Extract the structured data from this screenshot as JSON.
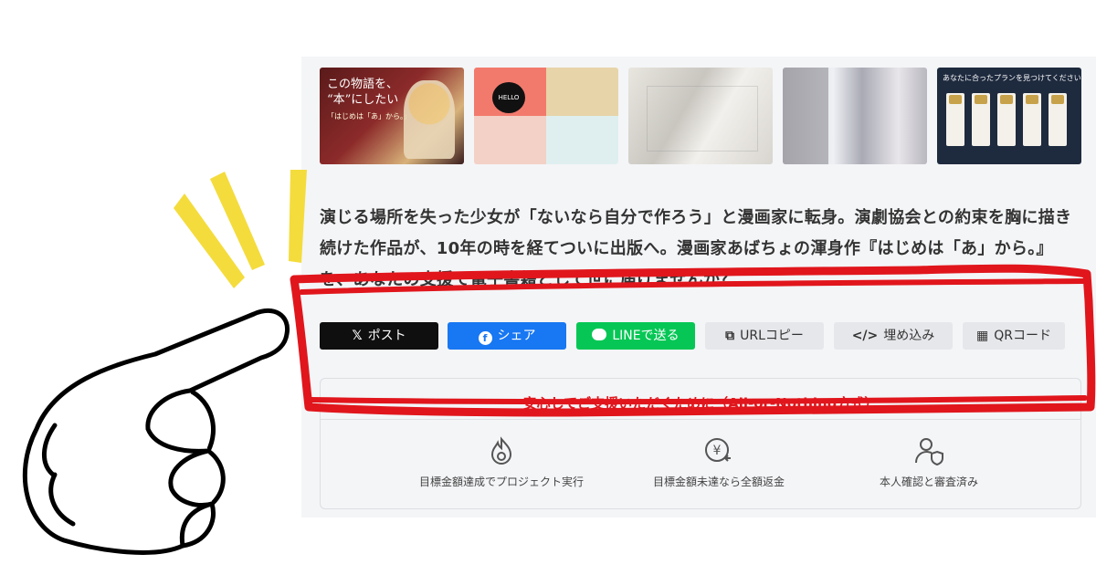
{
  "thumbnails": [
    {
      "title_line1": "この物語を、",
      "title_line2": "“本”にしたい",
      "subtitle": "「はじめは「あ」から。」"
    },
    {
      "text": "HELLO"
    },
    {},
    {},
    {
      "title": "あなたに合ったプランを見つけてください"
    }
  ],
  "description": "演じる場所を失った少女が「ないなら自分で作ろう」と漫画家に転身。演劇協会との約束を胸に描き続けた作品が、10年の時を経てついに出版へ。漫画家あばちょの渾身作『はじめは「あ」から。』を、あなたの支援で電子書籍として世に届けませんか？",
  "share": {
    "post": {
      "icon": "x-icon",
      "label": "ポスト"
    },
    "share": {
      "icon": "facebook-icon",
      "label": "シェア"
    },
    "line": {
      "icon": "line-icon",
      "label": "LINEで送る"
    },
    "url": {
      "icon": "copy-icon",
      "label": "URLコピー"
    },
    "embed": {
      "icon": "code-icon",
      "label": "埋め込み"
    },
    "qr": {
      "icon": "qr-icon",
      "label": "QRコード"
    }
  },
  "assurance": {
    "title": "安心してご支援いただくために（All-or-Nothing方式）",
    "items": [
      {
        "icon": "flame-icon",
        "label": "目標金額達成でプロジェクト実行"
      },
      {
        "icon": "yen-refund-icon",
        "label": "目標金額未達なら全額返金"
      },
      {
        "icon": "verified-user-icon",
        "label": "本人確認と審査済み"
      }
    ]
  },
  "colors": {
    "accent_red": "#e0161c",
    "x_black": "#0f0f0f",
    "facebook_blue": "#1877f2",
    "line_green": "#06c755",
    "highlight_yellow": "#f4dc3c"
  }
}
